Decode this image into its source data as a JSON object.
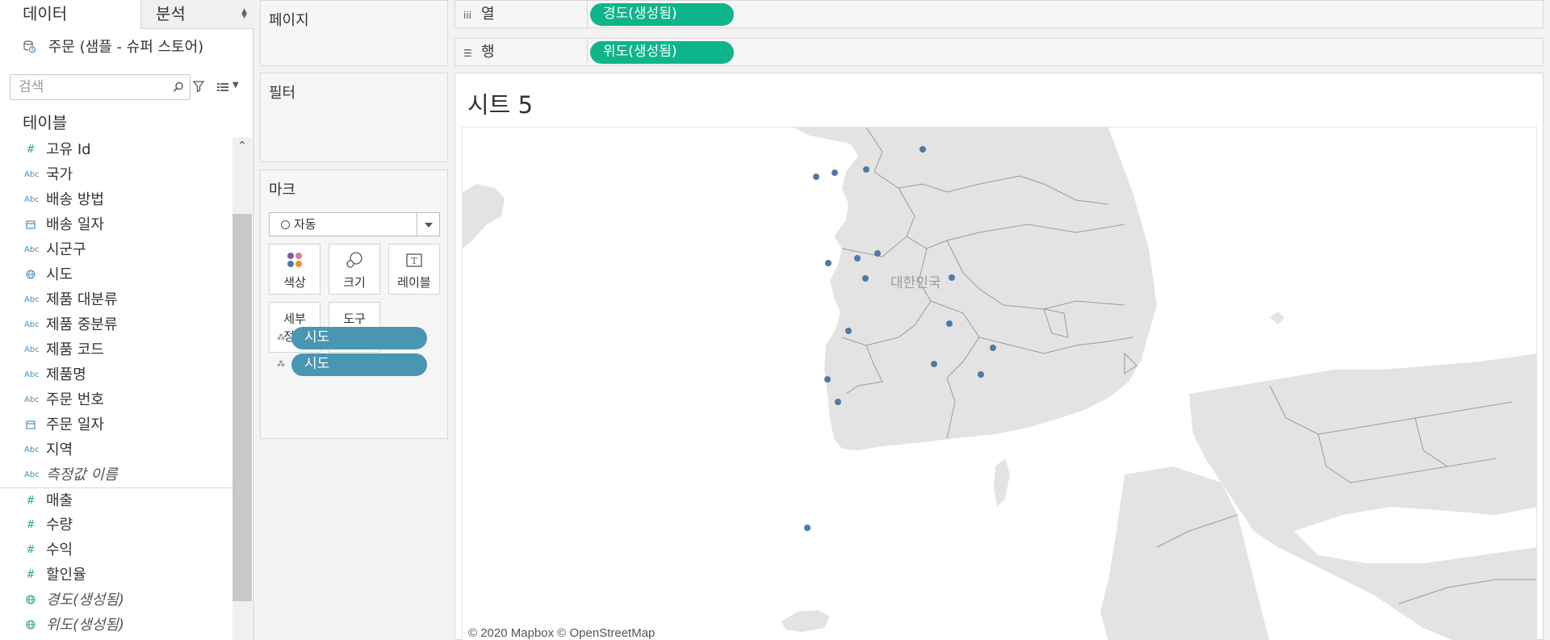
{
  "data_pane": {
    "tab_data": "데이터",
    "tab_analysis": "분석",
    "datasource": "주문 (샘플 - 슈퍼 스토어)",
    "search_placeholder": "검색",
    "tables_heading": "테이블",
    "fields": [
      {
        "name": "고유 Id",
        "type": "number",
        "icon": "#"
      },
      {
        "name": "국가",
        "type": "string",
        "icon": "Abc"
      },
      {
        "name": "배송 방법",
        "type": "string",
        "icon": "Abc"
      },
      {
        "name": "배송 일자",
        "type": "date",
        "icon": "calendar-icon"
      },
      {
        "name": "시군구",
        "type": "string",
        "icon": "Abc"
      },
      {
        "name": "시도",
        "type": "geo",
        "icon": "globe-icon"
      },
      {
        "name": "제품 대분류",
        "type": "string",
        "icon": "Abc"
      },
      {
        "name": "제품 중분류",
        "type": "string",
        "icon": "Abc"
      },
      {
        "name": "제품 코드",
        "type": "string",
        "icon": "Abc"
      },
      {
        "name": "제품명",
        "type": "string",
        "icon": "Abc"
      },
      {
        "name": "주문 번호",
        "type": "string",
        "icon": "Abc"
      },
      {
        "name": "주문 일자",
        "type": "date",
        "icon": "calendar-icon"
      },
      {
        "name": "지역",
        "type": "string",
        "icon": "Abc"
      },
      {
        "name": "측정값 이름",
        "type": "string",
        "icon": "Abc"
      },
      {
        "name": "매출",
        "type": "number",
        "icon": "#"
      },
      {
        "name": "수량",
        "type": "number",
        "icon": "#"
      },
      {
        "name": "수익",
        "type": "number",
        "icon": "#"
      },
      {
        "name": "할인율",
        "type": "number",
        "icon": "#"
      },
      {
        "name": "경도(생성됨)",
        "type": "geo",
        "icon": "globe-icon"
      },
      {
        "name": "위도(생성됨)",
        "type": "geo",
        "icon": "globe-icon"
      }
    ]
  },
  "cards": {
    "pages": "페이지",
    "filters": "필터",
    "marks": "마크",
    "mark_type": "자동",
    "buttons": {
      "color": "색상",
      "size": "크기",
      "label": "레이블",
      "detail": "세부\n정보",
      "tooltip": "도구\n설명"
    },
    "mark_pills": [
      "시도",
      "시도"
    ]
  },
  "shelves": {
    "columns_label": "열",
    "columns_pill": "경도(생성됨)",
    "rows_label": "행",
    "rows_pill": "위도(생성됨)"
  },
  "sheet": {
    "title": "시트 5",
    "map_country_label": "대한민국",
    "attribution": "© 2020 Mapbox © OpenStreetMap"
  },
  "colors": {
    "pill_green": "#0fb58a",
    "pill_blue": "#4996b2",
    "mark_dot": "#4e79a7"
  }
}
